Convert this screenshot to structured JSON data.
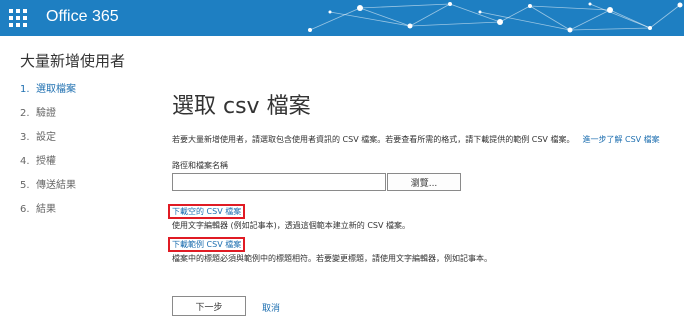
{
  "header": {
    "brand": "Office 365",
    "app_launcher_icon": "waffle-grid-icon",
    "color": "#1e7fc2"
  },
  "wizard": {
    "title": "大量新增使用者",
    "steps": [
      {
        "num": "1.",
        "label": "選取檔案",
        "active": true
      },
      {
        "num": "2.",
        "label": "驗證",
        "active": false
      },
      {
        "num": "3.",
        "label": "設定",
        "active": false
      },
      {
        "num": "4.",
        "label": "授權",
        "active": false
      },
      {
        "num": "5.",
        "label": "傳送結果",
        "active": false
      },
      {
        "num": "6.",
        "label": "結果",
        "active": false
      }
    ]
  },
  "main": {
    "heading": "選取 csv 檔案",
    "description": "若要大量新增使用者，請選取包含使用者資訊的 CSV 檔案。若要查看所需的格式，請下載提供的範例 CSV 檔案。",
    "learn_more": "進一步了解 CSV 檔案",
    "path_label": "路徑和檔案名稱",
    "path_value": "",
    "browse_label": "瀏覽...",
    "download_blank": "下載空的 CSV 檔案",
    "blank_hint": "使用文字編輯器 (例如記事本)，透過這個範本建立新的 CSV 檔案。",
    "download_sample": "下載範例 CSV 檔案",
    "sample_hint": "檔案中的標題必須與範例中的標題相符。若要變更標題，請使用文字編輯器，例如記事本。",
    "next_label": "下一步",
    "cancel_label": "取消"
  },
  "colors": {
    "accent": "#1e6fb0",
    "highlight_box": "#e01b24"
  }
}
